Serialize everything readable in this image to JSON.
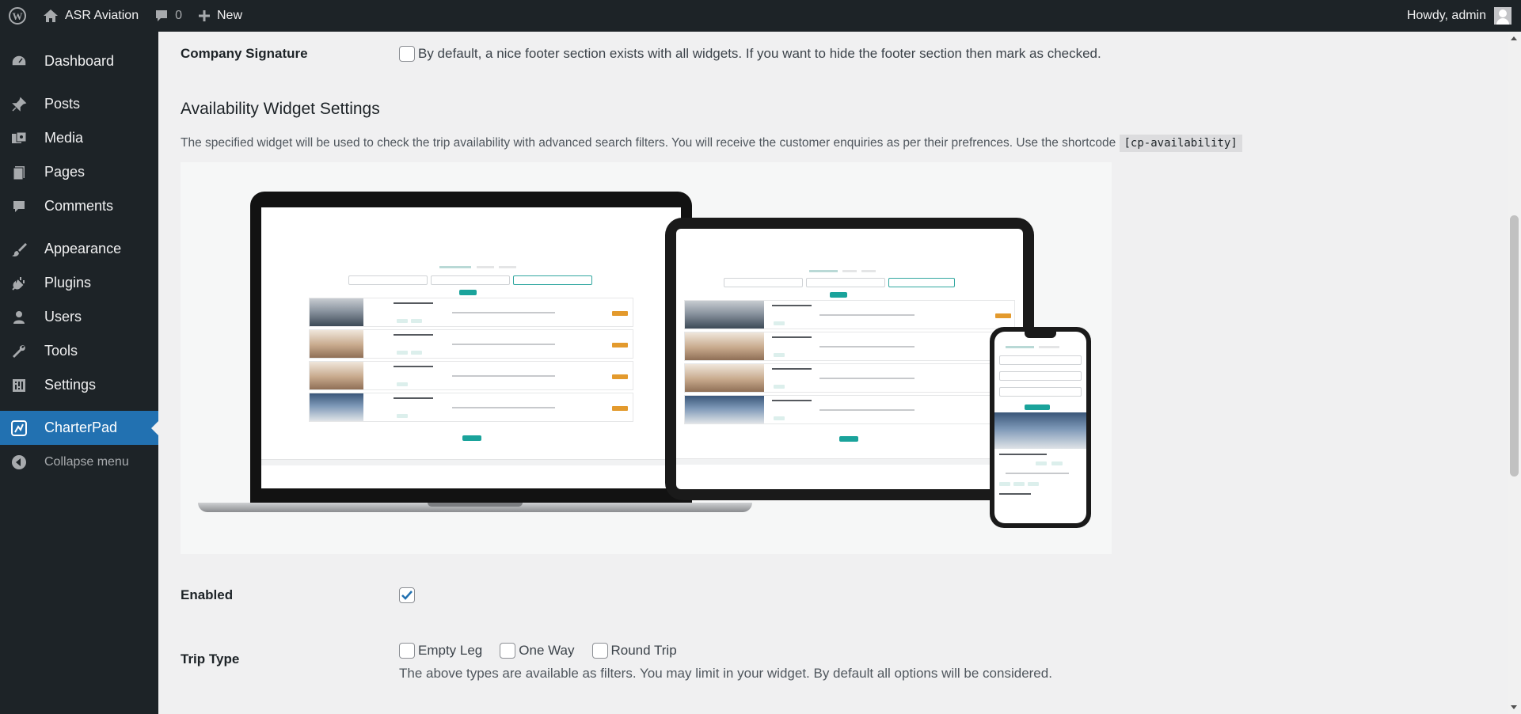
{
  "adminbar": {
    "site_name": "ASR Aviation",
    "comments_count": "0",
    "new_label": "New",
    "greeting": "Howdy, admin"
  },
  "sidebar": {
    "items": [
      {
        "label": "Dashboard",
        "icon": "dashboard-icon"
      },
      {
        "label": "Posts",
        "icon": "pin-icon"
      },
      {
        "label": "Media",
        "icon": "media-icon"
      },
      {
        "label": "Pages",
        "icon": "pages-icon"
      },
      {
        "label": "Comments",
        "icon": "comment-icon"
      },
      {
        "label": "Appearance",
        "icon": "paintbrush-icon"
      },
      {
        "label": "Plugins",
        "icon": "plugin-icon"
      },
      {
        "label": "Users",
        "icon": "user-icon"
      },
      {
        "label": "Tools",
        "icon": "wrench-icon"
      },
      {
        "label": "Settings",
        "icon": "settings-icon"
      },
      {
        "label": "CharterPad",
        "icon": "charterpad-icon",
        "current": true
      },
      {
        "label": "Collapse menu",
        "icon": "collapse-icon"
      }
    ]
  },
  "settings": {
    "company_signature": {
      "label": "Company Signature",
      "description": "By default, a nice footer section exists with all widgets. If you want to hide the footer section then mark as checked.",
      "checked": false
    },
    "availability": {
      "heading": "Availability Widget Settings",
      "description": "The specified widget will be used to check the trip availability with advanced search filters. You will receive the customer enquiries as per their prefrences. Use the shortcode",
      "shortcode": "[cp-availability]"
    },
    "enabled": {
      "label": "Enabled",
      "checked": true
    },
    "trip_type": {
      "label": "Trip Type",
      "options": [
        {
          "label": "Empty Leg",
          "checked": false
        },
        {
          "label": "One Way",
          "checked": false
        },
        {
          "label": "Round Trip",
          "checked": false
        }
      ],
      "help": "The above types are available as filters. You may limit in your widget. By default all options will be considered."
    }
  },
  "colors": {
    "adminbar_bg": "#1d2327",
    "menu_current": "#2271b1",
    "checkbox_checked": "#2271b1",
    "accent_teal": "#1aa39b",
    "accent_orange": "#e39a2d"
  }
}
